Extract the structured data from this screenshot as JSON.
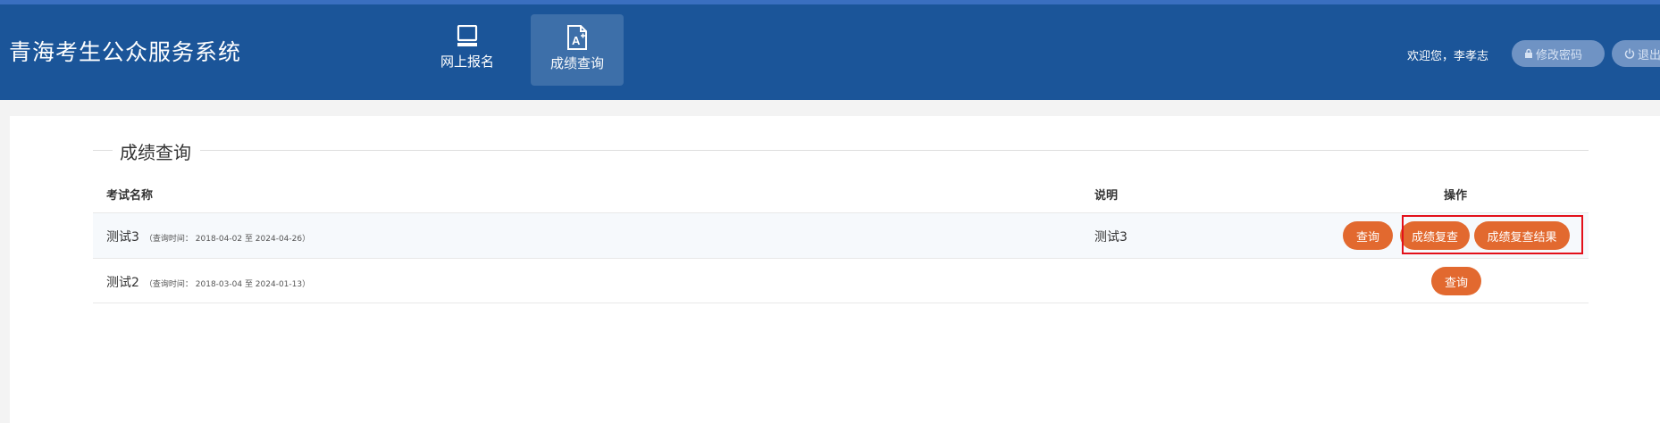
{
  "header": {
    "brand": "青海考生公众服务系统",
    "nav": [
      {
        "label": "网上报名",
        "icon": "monitor-icon",
        "active": false
      },
      {
        "label": "成绩查询",
        "icon": "document-grade-icon",
        "active": true
      }
    ],
    "welcome": "欢迎您，李孝志",
    "change_password": "修改密码",
    "logout": "退出"
  },
  "section": {
    "title": "成绩查询"
  },
  "table": {
    "columns": [
      "考试名称",
      "说明",
      "操作"
    ],
    "rows": [
      {
        "name": "测试3",
        "query_time": "（查询时间： 2018-04-02 至 2024-04-26）",
        "description": "测试3",
        "actions": [
          "查询",
          "成绩复查",
          "成绩复查结果"
        ]
      },
      {
        "name": "测试2",
        "query_time": "（查询时间： 2018-03-04 至 2024-01-13）",
        "description": "",
        "actions": [
          "查询"
        ]
      }
    ]
  },
  "colors": {
    "header_bg": "#1b5599",
    "active_nav_bg": "#3d6fa9",
    "action_button": "#e2692f",
    "highlight_border": "#e3101a"
  }
}
